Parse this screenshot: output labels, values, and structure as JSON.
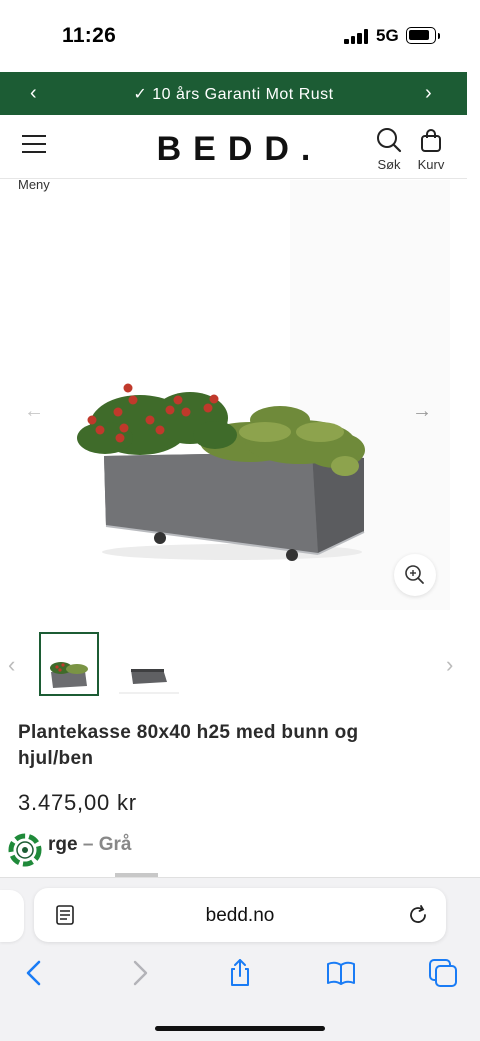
{
  "status": {
    "time": "11:26",
    "network": "5G"
  },
  "promo": {
    "text": "✓ 10 års Garanti Mot Rust",
    "prev": "‹",
    "next": "›"
  },
  "header": {
    "logo": "BEDD.",
    "menu_label": "Meny",
    "search_label": "Søk",
    "cart_label": "Kurv"
  },
  "gallery": {
    "prev_arrow": "←",
    "next_arrow": "→",
    "thumb_prev": "‹",
    "thumb_next": "›"
  },
  "product": {
    "title": "Plantekasse 80x40 h25 med bunn og hjul/ben",
    "price": "3.475,00 kr",
    "variant_label": "rge",
    "variant_separator": " – ",
    "variant_value": "Grå"
  },
  "browser": {
    "url": "bedd.no"
  },
  "colors": {
    "brand_green": "#1c5c34",
    "safari_blue": "#1a7cf5"
  },
  "icons": [
    "hamburger-icon",
    "search-icon",
    "cart-icon",
    "zoom-icon",
    "reader-icon",
    "reload-icon",
    "back-icon",
    "forward-icon",
    "share-icon",
    "bookmarks-icon",
    "tabs-icon"
  ]
}
